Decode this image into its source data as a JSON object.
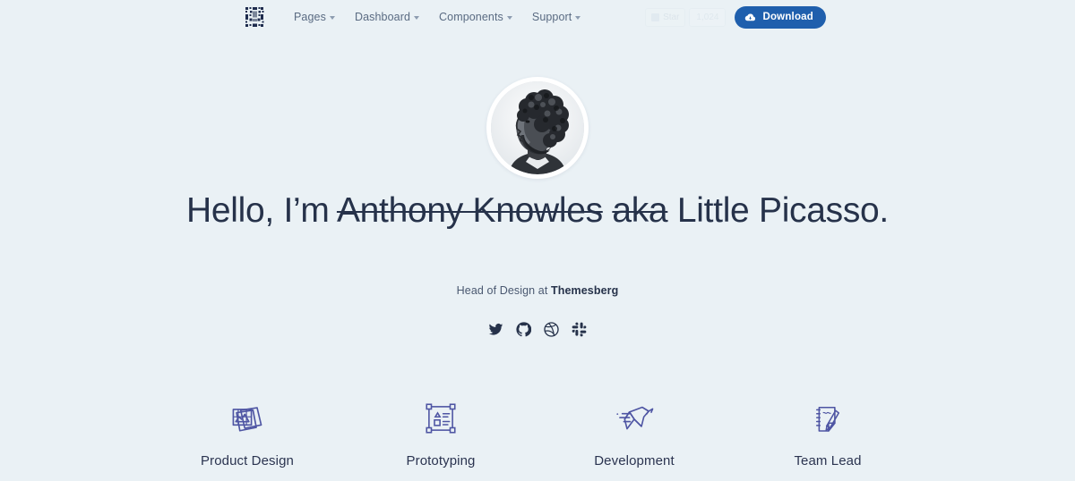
{
  "nav": {
    "logo_name": "themesberg-pixel-logo",
    "links": [
      {
        "label": "Pages",
        "has_caret": true
      },
      {
        "label": "Dashboard",
        "has_caret": true
      },
      {
        "label": "Components",
        "has_caret": true
      },
      {
        "label": "Support",
        "has_caret": true
      }
    ],
    "ghost_widget": {
      "label": "Star",
      "count": "1,024"
    },
    "download": {
      "label": "Download",
      "icon": "cloud-download-icon"
    }
  },
  "hero": {
    "avatar_alt": "portrait-photo-of-man-with-curly-hair-and-beard",
    "title_prefix": "Hello, I’m ",
    "title_struck_name": "Anthony Knowles",
    "title_struck_aka": "aka",
    "title_suffix": " Little Picasso.",
    "subtitle_prefix": "Head of Design at ",
    "subtitle_company": "Themesberg",
    "socials": [
      {
        "name": "twitter-icon",
        "label": "Twitter"
      },
      {
        "name": "github-icon",
        "label": "GitHub"
      },
      {
        "name": "dribbble-icon",
        "label": "Dribbble"
      },
      {
        "name": "slack-icon",
        "label": "Slack"
      }
    ]
  },
  "services": [
    {
      "label": "Product Design",
      "icon": "stacked-photos-icon"
    },
    {
      "label": "Prototyping",
      "icon": "artboard-wireframe-icon"
    },
    {
      "label": "Development",
      "icon": "origami-bird-icon"
    },
    {
      "label": "Team Lead",
      "icon": "notepad-pencil-icon"
    }
  ],
  "colors": {
    "background": "#eaf1f5",
    "accent_blue": "#1f5fad",
    "icon_purple": "#4e55a3",
    "text_dark": "#26324a",
    "text_muted": "#5a6b82"
  }
}
